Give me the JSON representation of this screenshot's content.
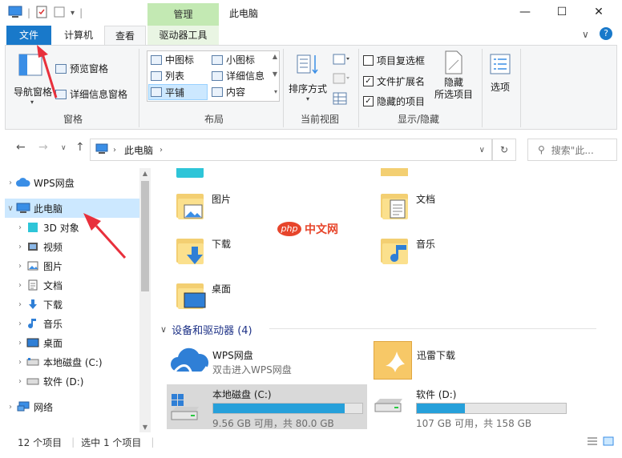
{
  "title_bar": {
    "context_tab": "管理",
    "window_title": "此电脑",
    "minimize": "—",
    "maximize": "☐",
    "close": "✕"
  },
  "tabs": {
    "file": "文件",
    "computer": "计算机",
    "view": "查看",
    "drive_tools": "驱动器工具"
  },
  "ribbon": {
    "panes": {
      "nav_pane": "导航窗格",
      "preview_pane": "预览窗格",
      "details_pane": "详细信息窗格",
      "label": "窗格"
    },
    "layout": {
      "medium_icons": "中图标",
      "small_icons": "小图标",
      "list": "列表",
      "details": "详细信息",
      "tiles": "平铺",
      "content": "内容",
      "label": "布局"
    },
    "current_view": {
      "sort_by": "排序方式",
      "label": "当前视图"
    },
    "show_hide": {
      "item_checkboxes": "项目复选框",
      "file_extensions": "文件扩展名",
      "hidden_items": "隐藏的项目",
      "hide_line1": "隐藏",
      "hide_line2": "所选项目",
      "label": "显示/隐藏"
    },
    "options": "选项"
  },
  "address": {
    "path_item": "此电脑",
    "search_placeholder": "搜索\"此..."
  },
  "nav_tree": {
    "wps": "WPS网盘",
    "this_pc": "此电脑",
    "objects3d": "3D 对象",
    "videos": "视频",
    "pictures": "图片",
    "documents": "文档",
    "downloads": "下载",
    "music": "音乐",
    "desktop": "桌面",
    "local_c": "本地磁盘 (C:)",
    "soft_d": "软件 (D:)",
    "network": "网络"
  },
  "folders": {
    "pictures": "图片",
    "documents": "文档",
    "downloads": "下载",
    "music": "音乐",
    "desktop": "桌面"
  },
  "devices_section": "设备和驱动器 (4)",
  "devices": {
    "wps_name": "WPS网盘",
    "wps_sub": "双击进入WPS网盘",
    "xunlei": "迅雷下载",
    "c_name": "本地磁盘 (C:)",
    "c_free": "9.56 GB 可用，共 80.0 GB",
    "c_used_fraction": 0.88,
    "d_name": "软件 (D:)",
    "d_free": "107 GB 可用，共 158 GB",
    "d_used_fraction": 0.32
  },
  "status": {
    "count": "12 个项目",
    "selected": "选中 1 个项目"
  },
  "watermark": {
    "logo": "php",
    "text": "中文网"
  },
  "colors": {
    "accent": "#1979ca",
    "selection": "#cce8ff",
    "context_tab": "#c3e9b3",
    "drive_fill": "#26a0da",
    "arrow": "#e8303c"
  }
}
